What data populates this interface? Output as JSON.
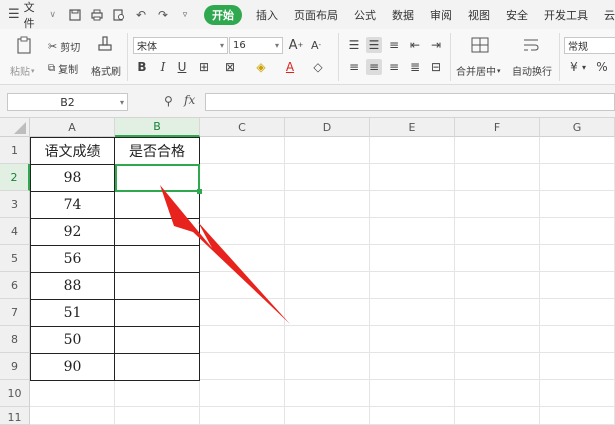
{
  "menu": {
    "file_label": "文件",
    "tabs": [
      "开始",
      "插入",
      "页面布局",
      "公式",
      "数据",
      "审阅",
      "视图",
      "安全",
      "开发工具",
      "云"
    ]
  },
  "ribbon": {
    "paste": "粘贴",
    "cut": "剪切",
    "copy": "复制",
    "format_painter": "格式刷",
    "font_name": "宋体",
    "font_size": "16",
    "merge_center": "合并居中",
    "wrap_text": "自动换行",
    "number_format": "常规"
  },
  "formula_bar": {
    "name_box": "B2",
    "fx_label": "fx",
    "formula": ""
  },
  "grid": {
    "columns": [
      "A",
      "B",
      "C",
      "D",
      "E",
      "F",
      "G"
    ],
    "rows": [
      "1",
      "2",
      "3",
      "4",
      "5",
      "6",
      "7",
      "8",
      "9",
      "10",
      "11"
    ],
    "header_a": "语文成绩",
    "header_b": "是否合格",
    "scores": [
      "98",
      "74",
      "92",
      "56",
      "88",
      "51",
      "50",
      "90"
    ],
    "selected_cell": "B2"
  },
  "colors": {
    "accent": "#2fa84f",
    "arrow": "#e8221c"
  }
}
